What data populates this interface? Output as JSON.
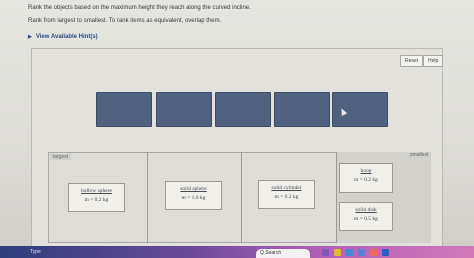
{
  "instructions": {
    "line1": "Rank the objects based on the maximum height they reach along the curved incline.",
    "line2": "Rank from largest to smallest. To rank items as equivalent, overlap them."
  },
  "hints_link": "View Available Hint(s)",
  "buttons": {
    "reset": "Reset",
    "help": "Help"
  },
  "rank_labels": {
    "largest": "largest",
    "smallest": "smallest"
  },
  "items": [
    {
      "name": "hollow sphere",
      "mass": "m = 0.2 kg"
    },
    {
      "name": "solid sphere",
      "mass": "m = 1.0 kg"
    },
    {
      "name": "solid cylinder",
      "mass": "m = 0.2 kg"
    },
    {
      "name": "hoop",
      "mass": "m = 0.2 kg"
    },
    {
      "name": "solid disk",
      "mass": "m = 0.5 kg"
    }
  ],
  "taskbar": {
    "left_text": "Type",
    "search_text": "Q Search"
  },
  "colors": {
    "slot": "#4f627f",
    "hint_link": "#2a4d8c"
  }
}
